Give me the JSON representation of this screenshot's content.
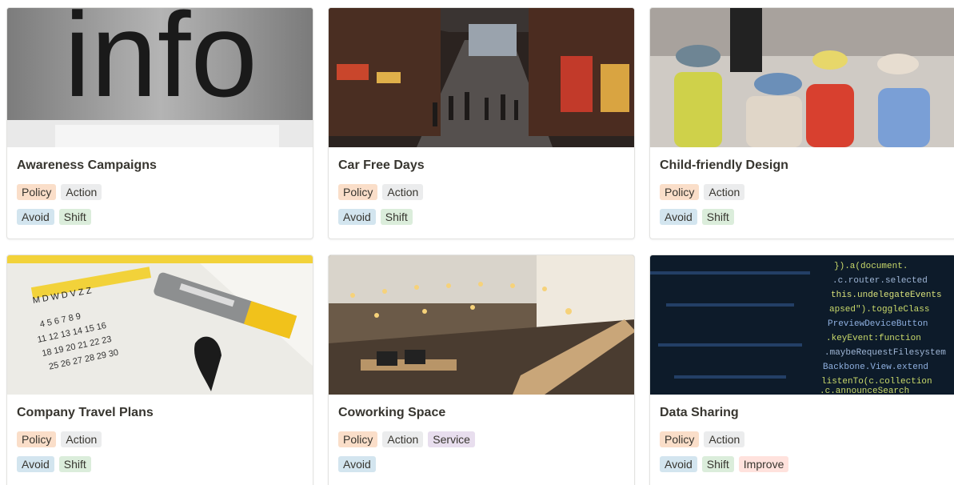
{
  "colors": {
    "policy": "#fadec9",
    "action": "#ebeced",
    "avoid": "#d3e5ef",
    "shift": "#dbeddb",
    "service": "#e8deee",
    "improve": "#ffe2dd"
  },
  "cards": [
    {
      "title": "Awareness Campaigns",
      "cover_text": "info",
      "cover_icon": "info-sign-photo",
      "tags_row1": [
        "Policy",
        "Action"
      ],
      "tags_row2": [
        "Avoid",
        "Shift"
      ]
    },
    {
      "title": "Car Free Days",
      "cover_icon": "pedestrian-street-photo",
      "tags_row1": [
        "Policy",
        "Action"
      ],
      "tags_row2": [
        "Avoid",
        "Shift"
      ]
    },
    {
      "title": "Child-friendly Design",
      "cover_icon": "children-crowd-photo",
      "tags_row1": [
        "Policy",
        "Action"
      ],
      "tags_row2": [
        "Avoid",
        "Shift"
      ]
    },
    {
      "title": "Company Travel Plans",
      "cover_icon": "calendar-marker-photo",
      "cover_calendar_header": "M D W D V Z Z",
      "cover_calendar_days": [
        "4 5 6 7 8 9",
        "11 12 13 14 15 16",
        "18 19 20 21 22 23",
        "25 26 27 28 29 30"
      ],
      "tags_row1": [
        "Policy",
        "Action"
      ],
      "tags_row2": [
        "Avoid",
        "Shift"
      ]
    },
    {
      "title": "Coworking Space",
      "cover_icon": "coworking-office-photo",
      "tags_row1": [
        "Policy",
        "Action",
        "Service"
      ],
      "tags_row2": [
        "Avoid"
      ]
    },
    {
      "title": "Data Sharing",
      "cover_icon": "code-screen-photo",
      "cover_code": [
        "}).a(document.",
        ".c.router.selected",
        "this.undelegateEvents",
        "apsed\").toggleClass",
        "PreviewDeviceButton",
        ".keyEvent:function",
        ".maybeRequestFilesystem",
        "Backbone.View.extend",
        "listenTo(c.collection",
        ".c.announceSearch"
      ],
      "tags_row1": [
        "Policy",
        "Action"
      ],
      "tags_row2": [
        "Avoid",
        "Shift",
        "Improve"
      ]
    }
  ]
}
